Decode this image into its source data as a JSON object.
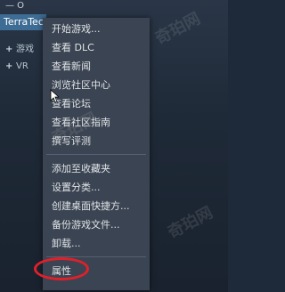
{
  "library": {
    "top_label": "— O",
    "selected_game": "TerraTec",
    "categories": [
      {
        "toggle": "+",
        "label": "游戏"
      },
      {
        "toggle": "+",
        "label": "VR"
      }
    ]
  },
  "context_menu": {
    "groups": [
      [
        "开始游戏...",
        "查看 DLC",
        "查看新闻",
        "浏览社区中心",
        "查看论坛",
        "查看社区指南",
        "撰写评测"
      ],
      [
        "添加至收藏夹",
        "设置分类...",
        "创建桌面快捷方...",
        "备份游戏文件...",
        "卸载..."
      ],
      [
        "属性"
      ]
    ]
  },
  "watermark_text": "奇珀网",
  "colors": {
    "background": "#1e2a3a",
    "menu_background": "#3b4452",
    "selection": "#3d6c95",
    "annotation_ring": "#e0202a"
  }
}
